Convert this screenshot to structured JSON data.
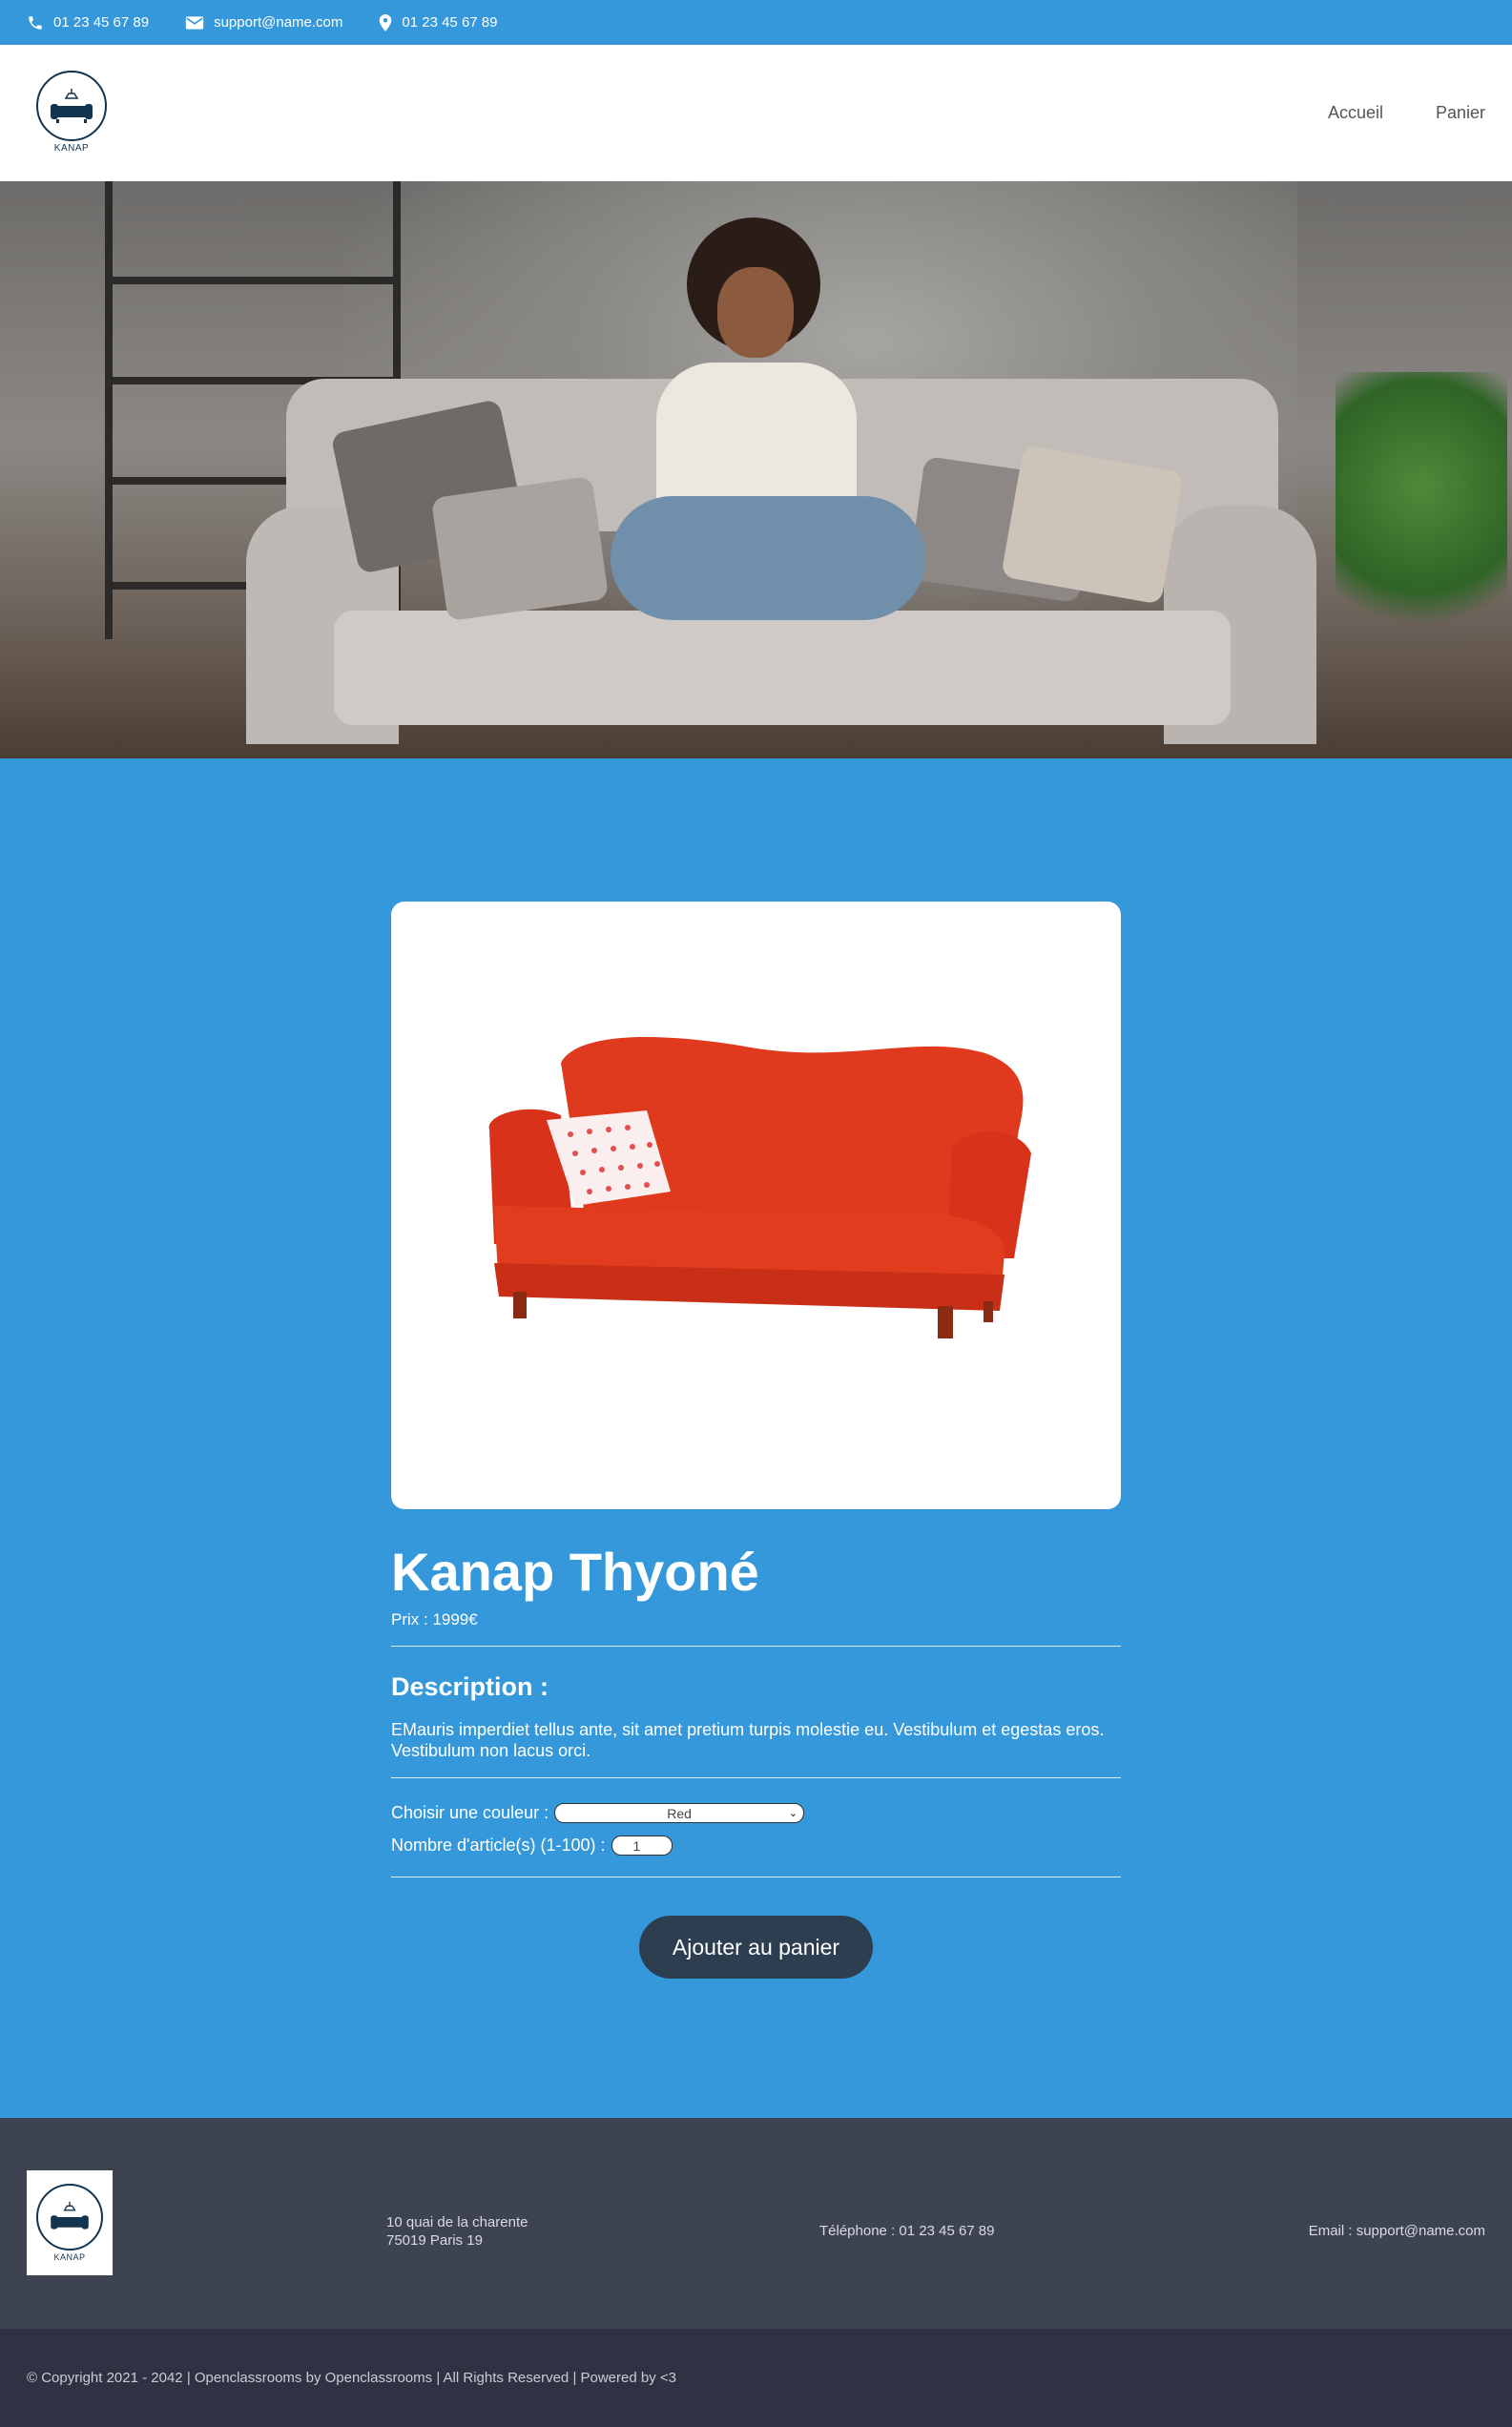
{
  "topbar": {
    "phone": "01 23 45 67 89",
    "email": "support@name.com",
    "location": "01 23 45 67 89"
  },
  "header": {
    "logo_text": "KANAP",
    "nav": [
      "Accueil",
      "Panier"
    ]
  },
  "product": {
    "title": "Kanap Thyoné",
    "price": "Prix : 1999€",
    "description_title": "Description :",
    "description": "EMauris imperdiet tellus ante, sit amet pretium turpis molestie eu. Vestibulum et egestas eros. Vestibulum non lacus orci.",
    "color_label": "Choisir une couleur :",
    "color_value": "Red",
    "qty_label": "Nombre d'article(s) (1-100) :",
    "qty_value": "1",
    "add_button": "Ajouter au panier"
  },
  "footer": {
    "logo_text": "KANAP",
    "address_line1": "10 quai de la charente",
    "address_line2": "75019 Paris 19",
    "phone": "Téléphone : 01 23 45 67 89",
    "email": "Email : support@name.com",
    "copyright": "© Copyright 2021 - 2042 | Openclassrooms by Openclassrooms | All Rights Reserved | Powered by <3"
  },
  "colors": {
    "primary": "#3498db",
    "dark_button": "#2c3e50",
    "footer": "#3d4351",
    "bottom_bar": "#2f3242",
    "sofa_red": "#e0361b"
  }
}
